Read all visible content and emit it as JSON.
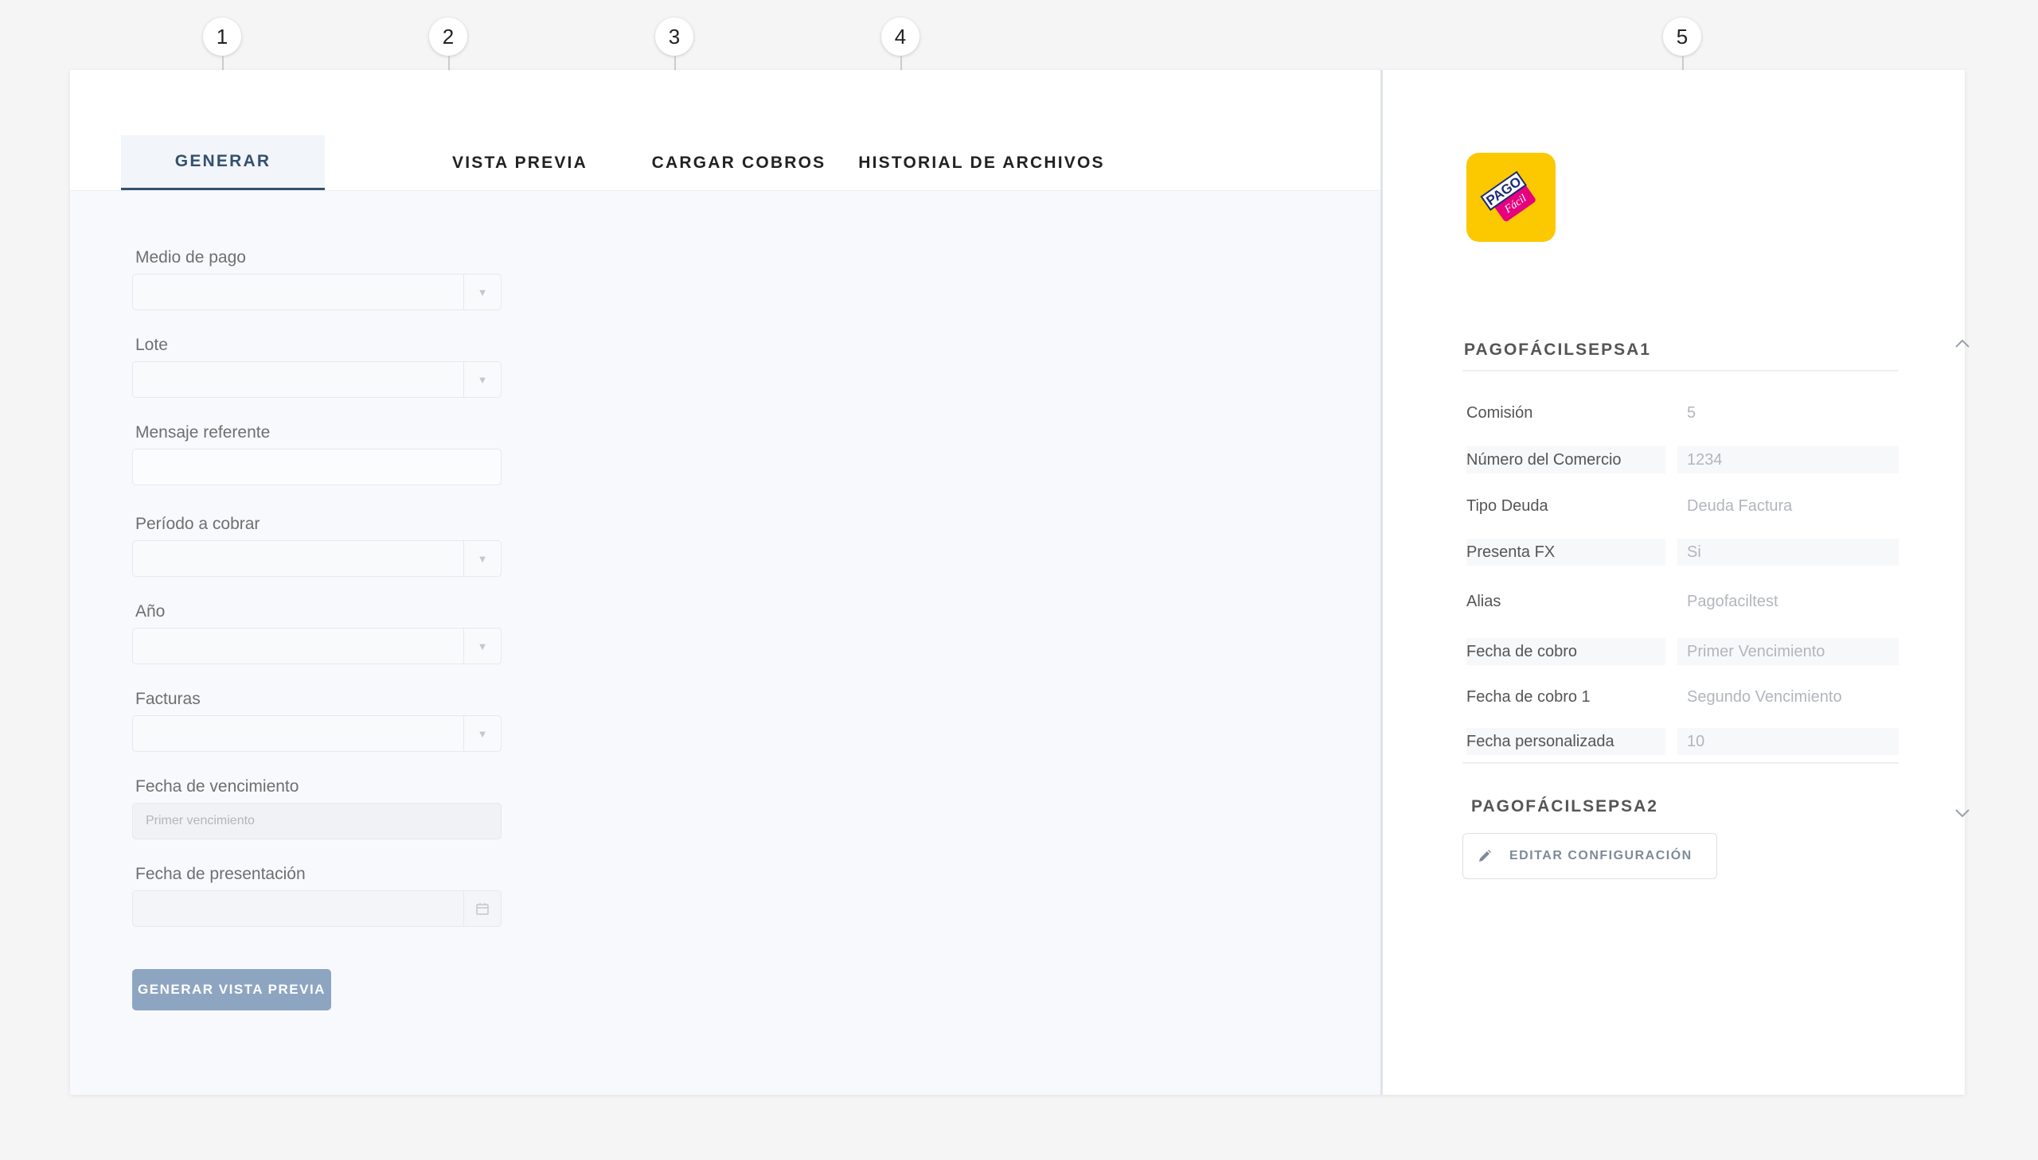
{
  "callouts": [
    "1",
    "2",
    "3",
    "4",
    "5"
  ],
  "tabs": [
    {
      "label": "GENERAR",
      "active": true
    },
    {
      "label": "VISTA PREVIA",
      "active": false
    },
    {
      "label": "CARGAR COBROS",
      "active": false
    },
    {
      "label": "HISTORIAL DE ARCHIVOS",
      "active": false
    }
  ],
  "form": {
    "medio_de_pago_label": "Medio de pago",
    "lote_label": "Lote",
    "mensaje_referente_label": "Mensaje referente",
    "periodo_label": "Período a cobrar",
    "anio_label": "Año",
    "facturas_label": "Facturas",
    "fecha_vencimiento_label": "Fecha de vencimiento",
    "fecha_vencimiento_value": "Primer vencimiento",
    "fecha_presentacion_label": "Fecha de presentación",
    "generate_button": "GENERAR VISTA PREVIA"
  },
  "config": {
    "logo_text_top": "PAGO",
    "logo_text_bottom": "Fácil",
    "section1_title": "PAGOFÁCILSEPSA1",
    "section2_title": "PAGOFÁCILSEPSA2",
    "rows": [
      {
        "label": "Comisión",
        "value": "5"
      },
      {
        "label": "Número del Comercio",
        "value": "1234"
      },
      {
        "label": "Tipo Deuda",
        "value": "Deuda Factura"
      },
      {
        "label": "Presenta FX",
        "value": "Si"
      },
      {
        "label": "Alias",
        "value": "Pagofaciltest"
      },
      {
        "label": "Fecha de cobro",
        "value": "Primer Vencimiento"
      },
      {
        "label": "Fecha de cobro 1",
        "value": "Segundo Vencimiento"
      },
      {
        "label": "Fecha personalizada",
        "value": "10"
      }
    ],
    "edit_button": "EDITAR CONFIGURACIÓN"
  },
  "colors": {
    "accent": "#34506e",
    "primary_button": "#8ea5c2",
    "logo_background": "#fcc800",
    "logo_badge": "#e6007e"
  }
}
